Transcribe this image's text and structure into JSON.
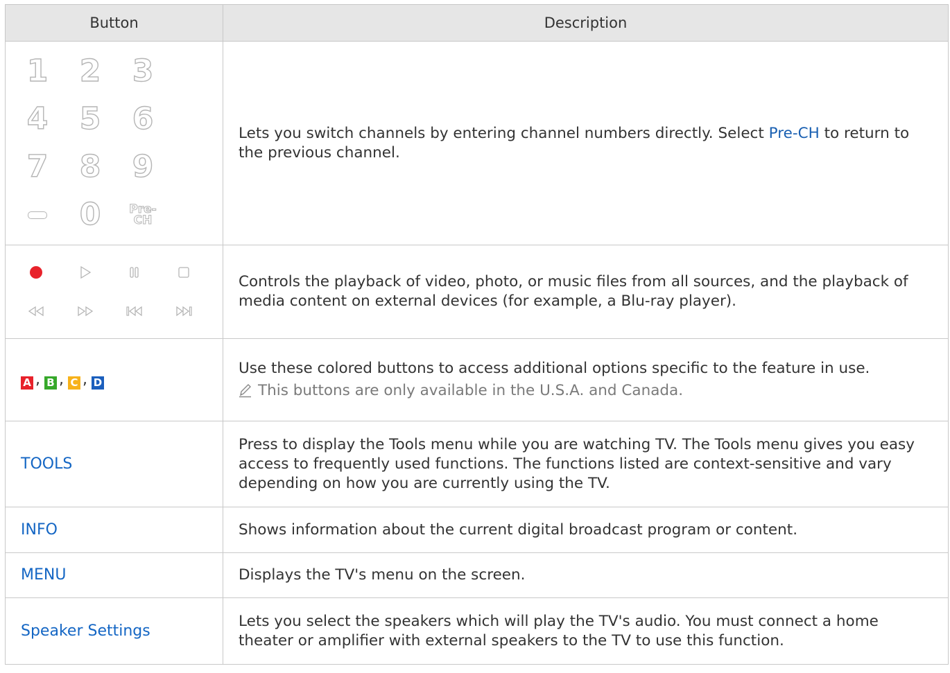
{
  "header": {
    "button": "Button",
    "description": "Description"
  },
  "rows": {
    "numbers": {
      "keys": [
        "1",
        "2",
        "3",
        "4",
        "5",
        "6",
        "7",
        "8",
        "9",
        "0"
      ],
      "prech_top": "Pre-",
      "prech_bottom": "CH",
      "desc_a": "Lets you switch channels by entering channel numbers directly. Select ",
      "desc_link": "Pre-CH",
      "desc_b": " to return to the previous channel."
    },
    "media": {
      "icons": [
        "record-icon",
        "play-icon",
        "pause-icon",
        "stop-icon",
        "rewind-icon",
        "fast-forward-icon",
        "previous-icon",
        "next-icon"
      ],
      "desc": "Controls the playback of video, photo, or music files from all sources, and the playback of media content on external devices (for example, a Blu-ray player)."
    },
    "colored": {
      "buttons": [
        {
          "label": "A",
          "color": "#e8222b"
        },
        {
          "label": "B",
          "color": "#36a82a"
        },
        {
          "label": "C",
          "color": "#f7b21b"
        },
        {
          "label": "D",
          "color": "#1b5fbd"
        }
      ],
      "separator": ",",
      "desc": "Use these colored buttons to access additional options specific to the feature in use.",
      "note": "This buttons are only available in the U.S.A. and Canada.",
      "note_icon": "pencil-icon"
    },
    "tools": {
      "label": "TOOLS",
      "desc": "Press to display the Tools menu while you are watching TV. The Tools menu gives you easy access to frequently used functions. The functions listed are context-sensitive and vary depending on how you are currently using the TV."
    },
    "info": {
      "label": "INFO",
      "desc": "Shows information about the current digital broadcast program or content."
    },
    "menu": {
      "label": "MENU",
      "desc": "Displays the TV's menu on the screen."
    },
    "speaker": {
      "label": "Speaker Settings",
      "desc": "Lets you select the speakers which will play the TV's audio. You must connect a home theater or amplifier with external speakers to the TV to use this function."
    }
  },
  "colors": {
    "accent": "#1466c4",
    "header_bg": "#e6e6e6",
    "border": "#c8c8c8"
  }
}
